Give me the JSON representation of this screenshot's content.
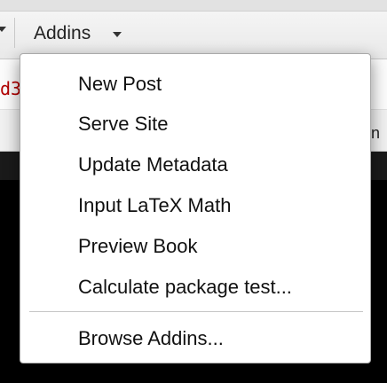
{
  "toolbar": {
    "addins_label": "Addins"
  },
  "editor": {
    "code_fragment": "d3",
    "tab_edge_text": "n"
  },
  "menu": {
    "items": [
      {
        "label": "New Post"
      },
      {
        "label": "Serve Site"
      },
      {
        "label": "Update Metadata"
      },
      {
        "label": "Input LaTeX Math"
      },
      {
        "label": "Preview Book"
      },
      {
        "label": "Calculate package test..."
      }
    ],
    "footer_item": {
      "label": "Browse Addins..."
    }
  },
  "icons": {
    "left_caret": "chevron-down-icon",
    "addins_caret": "chevron-down-icon"
  }
}
